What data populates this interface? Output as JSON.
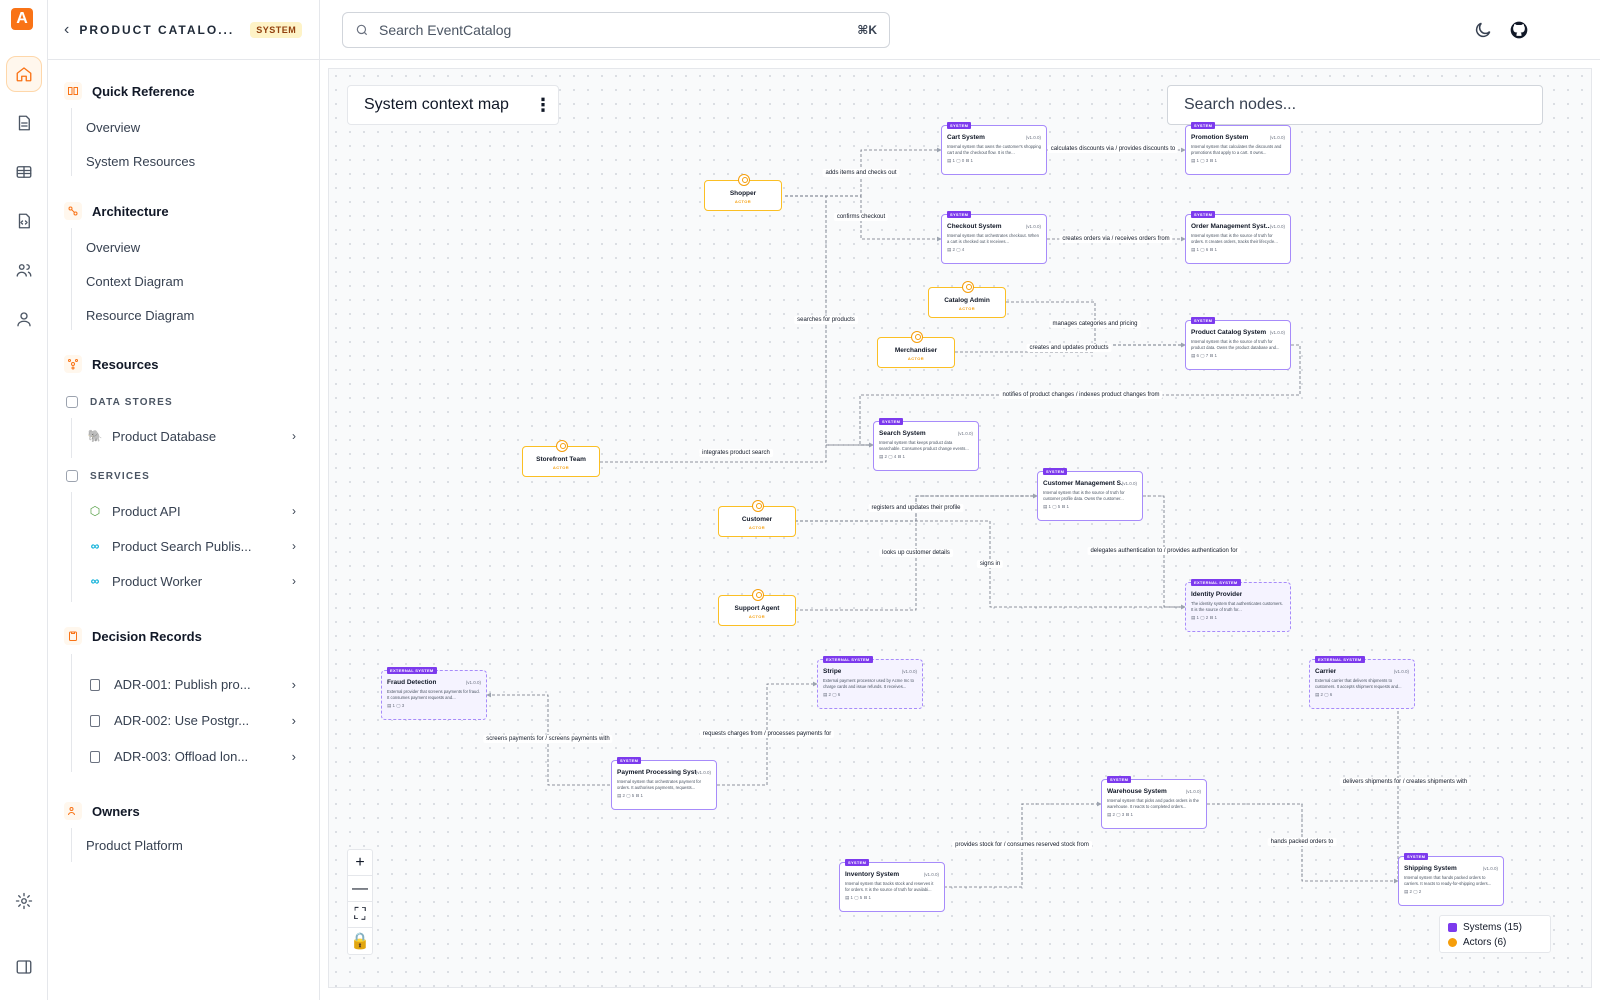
{
  "app": {
    "logo_letter": "A"
  },
  "rail": {
    "icons": [
      "home-icon",
      "document-icon",
      "table-icon",
      "code-file-icon",
      "users-icon",
      "user-icon",
      "settings-icon",
      "sidebar-toggle-icon"
    ]
  },
  "sidebar": {
    "title": "PRODUCT CATALO...",
    "badge": "SYSTEM",
    "sections": {
      "quick_reference": {
        "label": "Quick Reference",
        "links": [
          "Overview",
          "System Resources"
        ]
      },
      "architecture": {
        "label": "Architecture",
        "links": [
          "Overview",
          "Context Diagram",
          "Resource Diagram"
        ]
      },
      "resources": {
        "label": "Resources",
        "data_stores": {
          "label": "DATA STORES",
          "items": [
            "Product Database"
          ]
        },
        "services": {
          "label": "SERVICES",
          "items": [
            "Product API",
            "Product Search Publis...",
            "Product Worker"
          ]
        }
      },
      "decision_records": {
        "label": "Decision Records",
        "items": [
          "ADR-001: Publish pro...",
          "ADR-002: Use Postgr...",
          "ADR-003: Offload lon..."
        ]
      },
      "owners": {
        "label": "Owners",
        "items": [
          "Product Platform"
        ]
      }
    }
  },
  "topbar": {
    "search_placeholder": "Search EventCatalog",
    "shortcut": "⌘K"
  },
  "canvas": {
    "title": "System context map",
    "node_search_placeholder": "Search nodes...",
    "controls": [
      "+",
      "—",
      "⛶",
      "🔒"
    ],
    "legend": {
      "systems": "Systems (15)",
      "actors": "Actors (6)",
      "system_color": "#7c3aed",
      "actor_color": "#f59e0b"
    }
  },
  "labels": {
    "system_tag": "SYSTEM",
    "external_tag": "EXTERNAL SYSTEM",
    "actor_tag": "ACTOR"
  },
  "systems": [
    {
      "name": "Cart System",
      "version": "(v1.0.0)",
      "desc": "Internal system that owns the customer's shopping cart and the checkout flow. It is the...",
      "stats": "▤ 1  ▢ 0  ⊟ 1",
      "external": false
    },
    {
      "name": "Promotion System",
      "version": "(v1.0.0)",
      "desc": "Internal system that calculates the discounts and promotions that apply to a cart. It owns...",
      "stats": "▤ 1  ▢ 3  ⊟ 1",
      "external": false
    },
    {
      "name": "Checkout System",
      "version": "(v1.0.0)",
      "desc": "Internal system that orchestrates checkout. When a cart is checked out it receives...",
      "stats": "▤ 2  ▢ 4",
      "external": false
    },
    {
      "name": "Order Management Syst...",
      "version": "(v1.0.0)",
      "desc": "Internal system that is the source of truth for orders. It creates orders, tracks their lifecycle...",
      "stats": "▤ 1  ▢ 6  ⊟ 1",
      "external": false
    },
    {
      "name": "Product Catalog System",
      "version": "(v1.0.0)",
      "desc": "Internal system that is the source of truth for product data. Owns the product database and...",
      "stats": "▤ 6  ▢ 7  ⊟ 1",
      "external": false
    },
    {
      "name": "Search System",
      "version": "(v1.0.0)",
      "desc": "Internal system that keeps product data searchable. Consumes product change events...",
      "stats": "▤ 2  ▢ 4  ⊟ 1",
      "external": false
    },
    {
      "name": "Customer Management S...",
      "version": "(v1.0.0)",
      "desc": "Internal system that is the source of truth for customer profile data. Owns the customer...",
      "stats": "▤ 1  ▢ 5  ⊟ 1",
      "external": false
    },
    {
      "name": "Identity Provider",
      "version": "",
      "desc": "The identity system that authenticates customers. It is the source of truth for...",
      "stats": "▤ 1  ▢ 2  ⊟ 1",
      "external": true
    },
    {
      "name": "Fraud Detection",
      "version": "(v1.0.0)",
      "desc": "External provider that screens payments for fraud. It consumes payment requests and...",
      "stats": "▤ 1  ▢ 3",
      "external": true
    },
    {
      "name": "Stripe",
      "version": "(v1.0.0)",
      "desc": "External payment processor used by Acme Inc to charge cards and issue refunds. It receives...",
      "stats": "▤ 2  ▢ 6",
      "external": true
    },
    {
      "name": "Carrier",
      "version": "(v1.0.0)",
      "desc": "External carrier that delivers shipments to customers. It accepts shipment requests and...",
      "stats": "▤ 2  ▢ 6",
      "external": true
    },
    {
      "name": "Payment Processing Syst...",
      "version": "(v1.0.0)",
      "desc": "Internal system that orchestrates payment for orders. It authorises payments, requests...",
      "stats": "▤ 2  ▢ 5  ⊟ 1",
      "external": false
    },
    {
      "name": "Warehouse System",
      "version": "(v1.0.0)",
      "desc": "Internal system that picks and packs orders in the warehouse. It reacts to completed orders...",
      "stats": "▤ 2  ▢ 3  ⊟ 1",
      "external": false
    },
    {
      "name": "Inventory System",
      "version": "(v1.0.0)",
      "desc": "Internal system that tracks stock and reserves it for orders. It is the source of truth for availabi...",
      "stats": "▤ 1  ▢ 5  ⊟ 1",
      "external": false
    },
    {
      "name": "Shipping System",
      "version": "(v1.0.0)",
      "desc": "Internal system that hands packed orders to carriers. It reacts to ready-for-shipping orders...",
      "stats": "▤ 2  ▢ 2",
      "external": false
    }
  ],
  "actors": [
    "Shopper",
    "Catalog Admin",
    "Merchandiser",
    "Storefront Team",
    "Customer",
    "Support Agent"
  ],
  "edge_labels": [
    "adds items and checks out",
    "confirms checkout",
    "calculates discounts via / provides discounts to",
    "creates orders via / receives orders from",
    "searches for products",
    "manages categories and pricing",
    "creates and updates products",
    "notifies of product changes / indexes product changes from",
    "integrates product search",
    "registers and updates their profile",
    "delegates authentication to / provides authentication for",
    "looks up customer details",
    "signs in",
    "screens payments for / screens payments with",
    "requests charges from / processes payments for",
    "delivers shipments for / creates shipments with",
    "hands packed orders to",
    "provides stock for / consumes reserved stock from"
  ]
}
